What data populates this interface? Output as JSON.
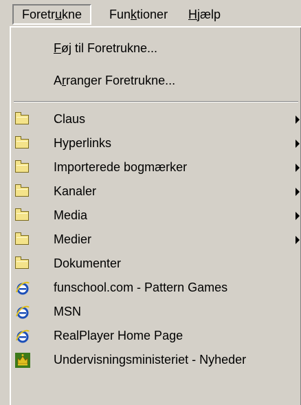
{
  "menubar": {
    "items": [
      {
        "pre": "Foretr",
        "u": "u",
        "post": "kne"
      },
      {
        "pre": "Fun",
        "u": "k",
        "post": "tioner"
      },
      {
        "pre": "",
        "u": "H",
        "post": "jælp"
      }
    ]
  },
  "menu": {
    "add_item": {
      "pre": "",
      "u": "F",
      "post": "øj til Foretrukne..."
    },
    "arrange_item": {
      "pre": "A",
      "u": "r",
      "post": "ranger Foretrukne..."
    },
    "folders": [
      {
        "label": "Claus",
        "submenu": true
      },
      {
        "label": "Hyperlinks",
        "submenu": true
      },
      {
        "label": "Importerede bogmærker",
        "submenu": true
      },
      {
        "label": "Kanaler",
        "submenu": true
      },
      {
        "label": "Media",
        "submenu": true
      },
      {
        "label": "Medier",
        "submenu": true
      },
      {
        "label": "Dokumenter",
        "submenu": false
      }
    ],
    "links": [
      {
        "label": "funschool.com - Pattern Games",
        "icon": "ie-icon"
      },
      {
        "label": "MSN",
        "icon": "ie-icon"
      },
      {
        "label": "RealPlayer Home Page",
        "icon": "ie-icon"
      },
      {
        "label": "Undervisningsministeriet - Nyheder",
        "icon": "crown-icon"
      }
    ]
  },
  "colors": {
    "menu_bg": "#d4d0c8",
    "folder_fill": "#f4e38a",
    "ie_blue": "#1c4fb8",
    "crown_green": "#3c7a1a",
    "crown_gold": "#e0c020"
  }
}
